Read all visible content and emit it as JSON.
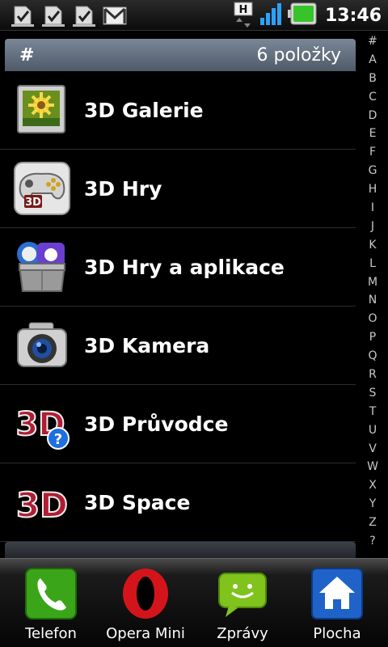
{
  "status_bar": {
    "time": "13:46",
    "network_type": "H",
    "icons": [
      "task-done-icon",
      "task-done-icon",
      "task-done-icon",
      "gmail-icon",
      "hspa-data-icon",
      "signal-strength-icon",
      "battery-icon"
    ]
  },
  "list_header": {
    "symbol": "#",
    "count": "6 položky"
  },
  "apps": [
    {
      "label": "3D Galerie",
      "icon": "gallery-icon"
    },
    {
      "label": "3D Hry",
      "icon": "gamepad-icon"
    },
    {
      "label": "3D Hry a aplikace",
      "icon": "app-store-box-icon"
    },
    {
      "label": "3D Kamera",
      "icon": "camera-icon"
    },
    {
      "label": "3D Průvodce",
      "icon": "3d-help-icon"
    },
    {
      "label": "3D Space",
      "icon": "3d-logo-icon"
    }
  ],
  "alphabet_index": [
    "#",
    "A",
    "B",
    "C",
    "D",
    "E",
    "F",
    "G",
    "H",
    "I",
    "J",
    "K",
    "L",
    "M",
    "N",
    "O",
    "P",
    "Q",
    "R",
    "S",
    "T",
    "U",
    "V",
    "W",
    "X",
    "Y",
    "Z",
    "?"
  ],
  "dock": [
    {
      "label": "Telefon",
      "icon": "phone-icon"
    },
    {
      "label": "Opera Mini",
      "icon": "opera-icon"
    },
    {
      "label": "Zprávy",
      "icon": "messages-icon"
    },
    {
      "label": "Plocha",
      "icon": "home-icon"
    }
  ],
  "colors": {
    "header_bg": "#6b7888",
    "background": "#000000",
    "battery": "#37c42a",
    "signal": "#2aa3ff"
  }
}
